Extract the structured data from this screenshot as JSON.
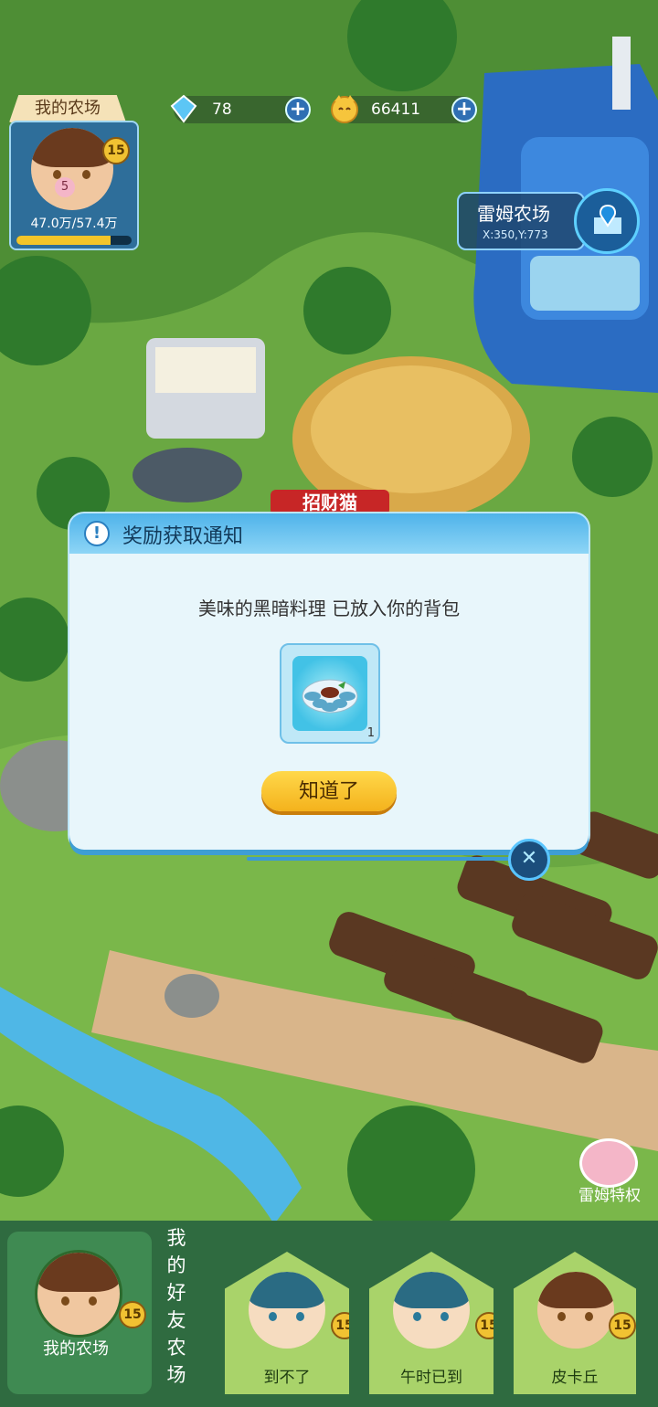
{
  "resources": {
    "gems": "78",
    "coins": "66411"
  },
  "my_farm": {
    "tab_label": "我的农场",
    "level": "15",
    "pet_level": "5",
    "progress_text": "47.0万/57.4万",
    "progress": 0.82
  },
  "location": {
    "name": "雷姆农场",
    "coords": "X:350,Y:773"
  },
  "dialog": {
    "title": "奖励获取通知",
    "message": "美味的黑暗料理 已放入你的背包",
    "item_count": "1",
    "confirm_label": "知道了"
  },
  "scene": {
    "sign_text": "招财猫"
  },
  "privilege_label": "雷姆特权",
  "bottom_bar": {
    "my_farm_label": "我的农场",
    "my_farm_level": "15",
    "friends_heading": "我的好友农场",
    "friends": [
      {
        "name": "到不了",
        "level": "15"
      },
      {
        "name": "午时已到",
        "level": "15"
      },
      {
        "name": "皮卡丘",
        "level": "15"
      }
    ]
  }
}
